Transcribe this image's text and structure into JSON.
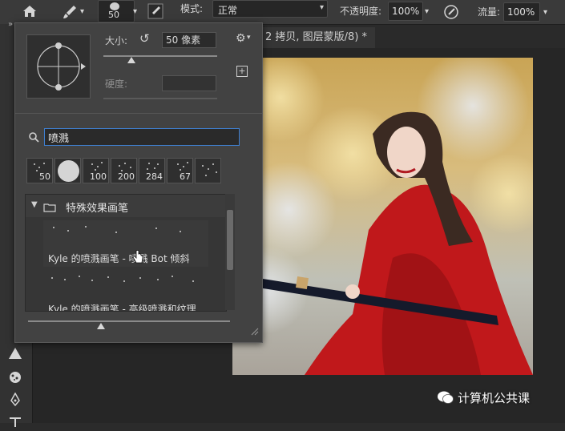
{
  "options_bar": {
    "brush_size": "50",
    "mode_label": "模式:",
    "mode_value": "正常",
    "opacity_label": "不透明度:",
    "opacity_value": "100%",
    "flow_label": "流量:",
    "flow_value": "100%"
  },
  "document_tab": {
    "title": "2 拷贝, 图层蒙版/8) *"
  },
  "brush_panel": {
    "size_label": "大小:",
    "size_value": "50 像素",
    "hardness_label": "硬度:",
    "search_value": "喷溅",
    "presets": [
      {
        "size": "50"
      },
      {
        "size": ""
      },
      {
        "size": "100"
      },
      {
        "size": "200"
      },
      {
        "size": "284"
      },
      {
        "size": "67"
      },
      {
        "size": ""
      }
    ],
    "group_name": "特殊效果画笔",
    "brushes": [
      {
        "name": "Kyle 的喷溅画笔 - 喷溅 Bot 倾斜"
      },
      {
        "name": "Kyle 的喷溅画笔 - 高级喷溅和纹理"
      }
    ]
  },
  "watermark": {
    "text": "计算机公共课"
  }
}
